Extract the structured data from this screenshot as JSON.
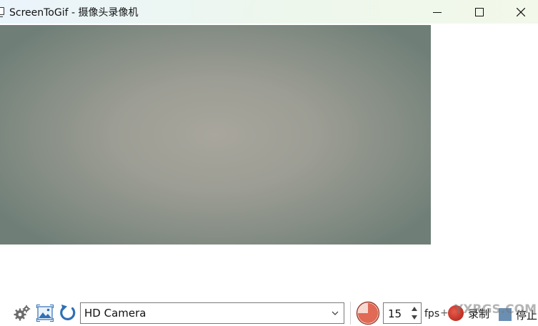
{
  "window": {
    "title": "ScreenToGif - 摄像头录像机",
    "buttons": {
      "minimize": "minimize-icon",
      "maximize": "maximize-icon",
      "close": "close-icon"
    }
  },
  "preview": {
    "description_icon": "camera-feed"
  },
  "toolbar": {
    "camera_select": {
      "selected": "HD Camera"
    },
    "fps": {
      "value": "15",
      "unit": "fps"
    },
    "plus": "+",
    "record_label": "录制",
    "stop_label": "停止"
  },
  "watermark": "YXRGS.COM",
  "colors": {
    "record": "#c0392b",
    "timer": "#e06a55",
    "stop": "#6a8fb3",
    "refresh": "#2f6fb5"
  }
}
